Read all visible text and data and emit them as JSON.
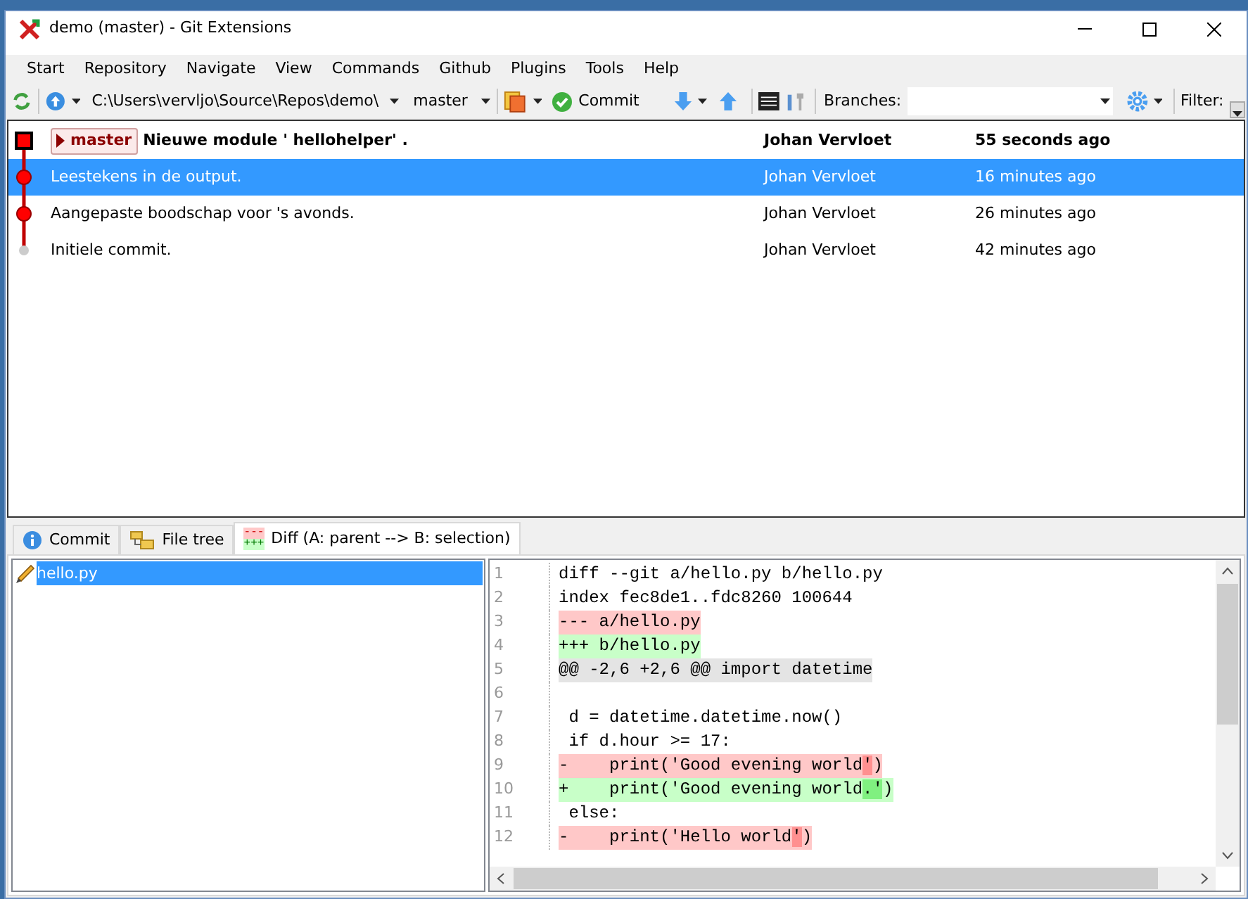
{
  "window": {
    "title": "demo (master) - Git Extensions"
  },
  "menu": [
    "Start",
    "Repository",
    "Navigate",
    "View",
    "Commands",
    "Github",
    "Plugins",
    "Tools",
    "Help"
  ],
  "toolbar": {
    "repository": "C:\\Users\\vervljo\\Source\\Repos\\demo\\",
    "branch": "master",
    "commit_button": "Commit",
    "branches_label": "Branches:",
    "filter_label": "Filter:"
  },
  "commits": [
    {
      "kind": "head",
      "branches": [
        "master"
      ],
      "message": "Nieuwe module ' hellohelper' .",
      "author": "Johan Vervloet",
      "date": "55 seconds ago",
      "selected": false
    },
    {
      "kind": "commit",
      "message": "Leestekens in de output.",
      "author": "Johan Vervloet",
      "date": "16 minutes ago",
      "selected": true
    },
    {
      "kind": "commit",
      "message": "Aangepaste boodschap voor 's avonds.",
      "author": "Johan Vervloet",
      "date": "26 minutes ago",
      "selected": false
    },
    {
      "kind": "root",
      "message": "Initiele commit.",
      "author": "Johan Vervloet",
      "date": "42 minutes ago",
      "selected": false
    }
  ],
  "tabs": [
    {
      "kind": "info",
      "label": "Commit",
      "selected": false
    },
    {
      "kind": "tree",
      "label": "File tree",
      "selected": false
    },
    {
      "kind": "diff",
      "label": "Diff (A: parent --> B: selection)",
      "selected": true
    }
  ],
  "diff_icon": {
    "removed": "---",
    "added": "+++"
  },
  "files": [
    {
      "name": "hello.py",
      "selected": true
    }
  ],
  "diff": [
    {
      "number": "1",
      "kind": "context",
      "text": "diff --git a/hello.py b/hello.py"
    },
    {
      "number": "2",
      "kind": "context",
      "text": "index fec8de1..fdc8260 100644"
    },
    {
      "number": "3",
      "kind": "removed",
      "parts": [
        {
          "text": "--- a/hello.py",
          "strong": false
        }
      ]
    },
    {
      "number": "4",
      "kind": "added",
      "parts": [
        {
          "text": "+++ b/hello.py",
          "strong": false
        }
      ]
    },
    {
      "number": "5",
      "kind": "hunk",
      "parts": [
        {
          "text": "@@ -2,6 +2,6 @@ import datetime",
          "strong": false
        }
      ]
    },
    {
      "number": "6"
    },
    {
      "number": "7",
      "kind": "context",
      "text": " d = datetime.datetime.now()"
    },
    {
      "number": "8",
      "kind": "context",
      "text": " if d.hour >= 17:"
    },
    {
      "number": "9",
      "kind": "removed",
      "parts": [
        {
          "text": "-    print('Good evening world",
          "strong": false
        },
        {
          "text": "'",
          "strong": true
        },
        {
          "text": ")",
          "strong": false
        }
      ]
    },
    {
      "number": "10",
      "kind": "added",
      "parts": [
        {
          "text": "+    print('Good evening world",
          "strong": false
        },
        {
          "text": ".'",
          "strong": true
        },
        {
          "text": ")",
          "strong": false
        }
      ]
    },
    {
      "number": "11",
      "kind": "context",
      "text": " else:"
    },
    {
      "number": "12",
      "kind": "removed",
      "parts": [
        {
          "text": "-    print('Hello world",
          "strong": false
        },
        {
          "text": "'",
          "strong": true
        },
        {
          "text": ")",
          "strong": false
        }
      ]
    }
  ]
}
